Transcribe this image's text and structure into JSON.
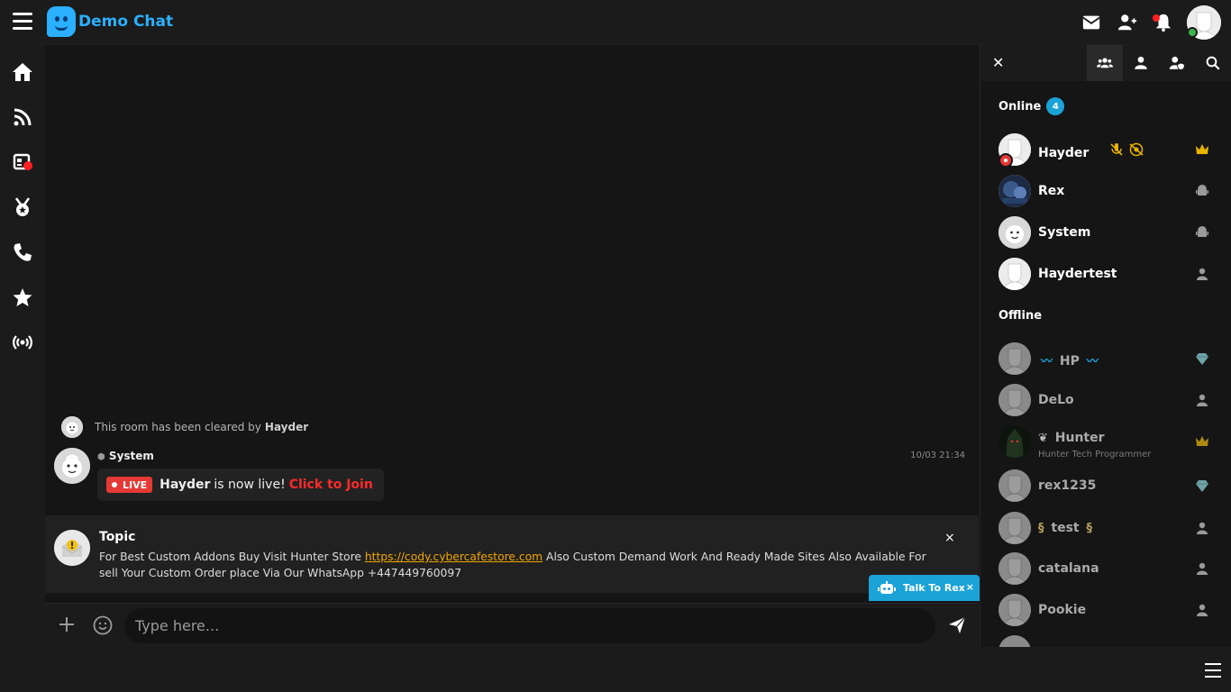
{
  "app": {
    "name": "Demo Chat",
    "brand_color": "#2ab0ff"
  },
  "topbar_icons": [
    "menu-icon",
    "envelope-icon",
    "add-user-icon",
    "bell-icon",
    "user-avatar"
  ],
  "left_nav": [
    "home-icon",
    "rss-icon",
    "news-icon",
    "medal-icon",
    "phone-icon",
    "star-icon",
    "broadcast-icon"
  ],
  "chat": {
    "cleared_notice": "This room has been cleared by",
    "cleared_by": "Hayder",
    "message": {
      "sender": "System",
      "time": "10/03 21:34",
      "live_label": "LIVE",
      "live_user": "Hayder",
      "live_text": "is now live!",
      "join_text": "Click to Join"
    },
    "topic": {
      "title": "Topic",
      "text_before": "For Best Custom Addons Buy Visit Hunter Store",
      "link": "https://cody.cybercafestore.com",
      "text_after": "Also Custom Demand Work And Ready Made Sites Also Available For sell Your Custom Order place Via Our WhatsApp +447449760097",
      "close": "×"
    },
    "talk_to_rex": {
      "label": "Talk To Rex",
      "close": "×"
    },
    "input": {
      "placeholder": "Type here..."
    }
  },
  "right_panel": {
    "close": "✕",
    "online_label": "Online",
    "online_count": "4",
    "offline_label": "Offline",
    "online_users": [
      {
        "name": "Hayder",
        "rank": "crown"
      },
      {
        "name": "Rex",
        "rank": "android"
      },
      {
        "name": "System",
        "rank": "android"
      },
      {
        "name": "Haydertest",
        "rank": "user"
      }
    ],
    "offline_users": [
      {
        "name": "HP",
        "rank": "diamond"
      },
      {
        "name": "DeLo",
        "rank": "user"
      },
      {
        "name": "Hunter",
        "mood": "Hunter Tech Programmer",
        "rank": "crown"
      },
      {
        "name": "rex1235",
        "rank": "diamond"
      },
      {
        "name": "test",
        "rank": "user"
      },
      {
        "name": "catalana",
        "rank": "user"
      },
      {
        "name": "Pookie",
        "rank": "user"
      }
    ]
  },
  "colors": {
    "live_red": "#e53935",
    "accent_blue": "#1ba3d8",
    "link_orange": "#f0a500",
    "crown_gold": "#e8b400"
  }
}
